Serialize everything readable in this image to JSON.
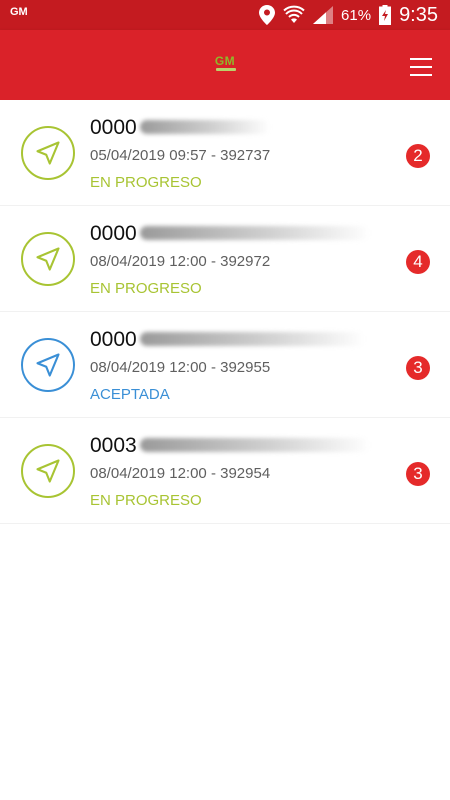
{
  "status_bar": {
    "left_label": "GM",
    "battery_percent": "61%",
    "time": "9:35"
  },
  "app_bar": {
    "logo_text": "GM",
    "menu_icon": "hamburger-menu-icon"
  },
  "colors": {
    "progress": "#a8c433",
    "accepted": "#3a8fd6",
    "badge": "#e52a2a",
    "header": "#da2229"
  },
  "items": [
    {
      "title": "0000",
      "subtitle": "05/04/2019 09:57 - 392737",
      "status": "EN PROGRESO",
      "badge": "2",
      "icon": "navigation-arrow-icon"
    },
    {
      "title": "0000",
      "subtitle": "08/04/2019 12:00 - 392972",
      "status": "EN PROGRESO",
      "badge": "4",
      "icon": "navigation-arrow-icon"
    },
    {
      "title": "0000",
      "subtitle": "08/04/2019 12:00 - 392955",
      "status": "ACEPTADA",
      "badge": "3",
      "icon": "navigation-arrow-icon"
    },
    {
      "title": "0003",
      "subtitle": "08/04/2019 12:00 - 392954",
      "status": "EN PROGRESO",
      "badge": "3",
      "icon": "navigation-arrow-icon"
    }
  ]
}
